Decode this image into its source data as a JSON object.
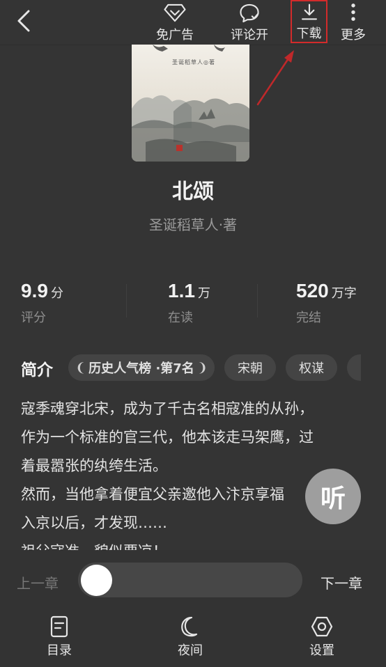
{
  "toolbar": {
    "ad_label": "免广告",
    "comment_label": "评论开",
    "download_label": "下载",
    "more_label": "更多"
  },
  "book": {
    "title": "北颂",
    "author": "圣诞稻草人·著",
    "cover_author_text": "圣诞稻草人◎著"
  },
  "stats": [
    {
      "value": "9.9",
      "unit": "分",
      "label": "评分"
    },
    {
      "value": "1.1",
      "unit": "万",
      "label": "在读"
    },
    {
      "value": "520",
      "unit": "万字",
      "label": "完结"
    }
  ],
  "intro": {
    "heading": "简介",
    "tags": [
      "历史人气榜 ·第7名",
      "宋朝",
      "权谋"
    ],
    "lines": [
      "寇季魂穿北宋，成为了千古名相寇准的从孙，",
      "作为一个标准的官三代，他本该走马架鹰，过",
      "着最嚣张的纨绔生活。",
      "然而，当他拿着便宜父亲邀他入汴京享福",
      "入京以后，才发现……",
      "祖父寇准，貌似要凉！"
    ]
  },
  "listen_label": "听",
  "reader": {
    "prev_label": "上一章",
    "next_label": "下一章"
  },
  "bottom_nav": {
    "toc_label": "目录",
    "night_label": "夜间",
    "settings_label": "设置"
  },
  "colors": {
    "background": "#343434",
    "highlight": "#d32b2b"
  }
}
